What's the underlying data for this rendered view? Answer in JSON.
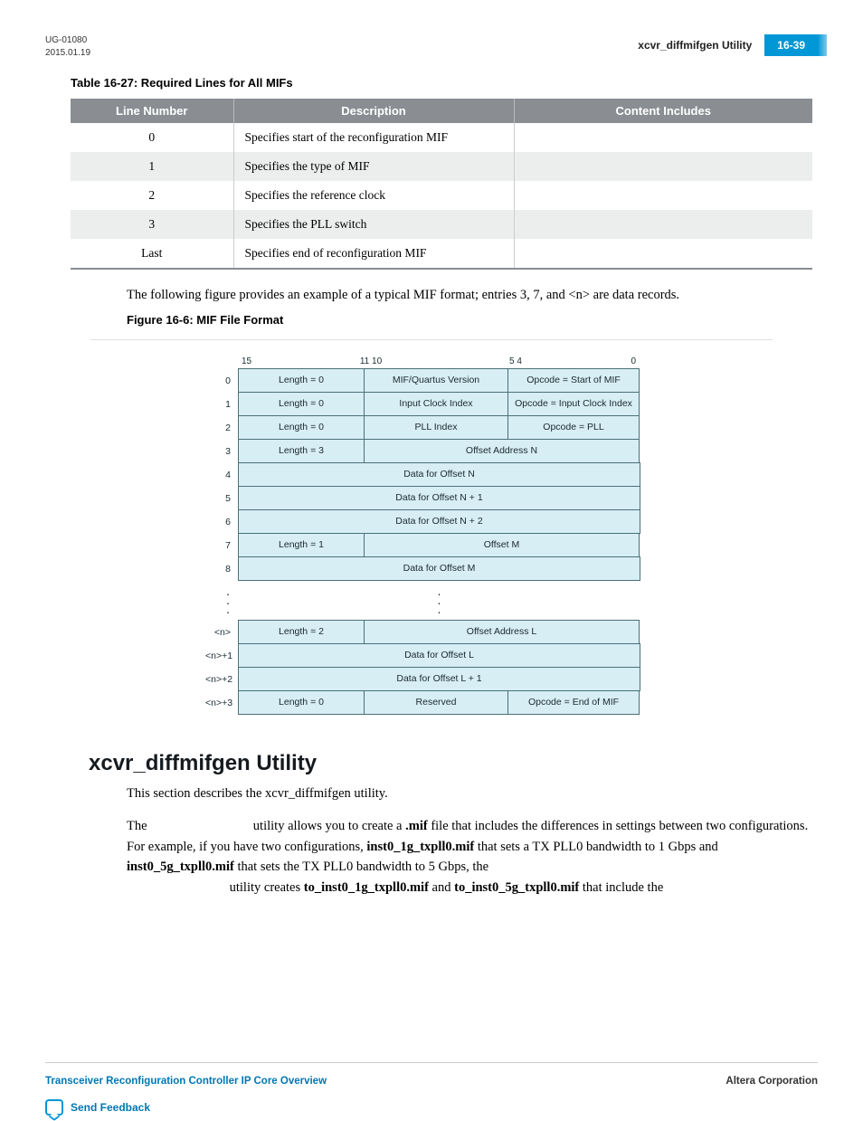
{
  "header": {
    "doc_id": "UG-01080",
    "date": "2015.01.19",
    "running_title": "xcvr_diffmifgen Utility",
    "page_ref": "16-39"
  },
  "table_caption": "Table 16-27: Required Lines for All MIFs",
  "table_headers": {
    "h1": "Line Number",
    "h2": "Description",
    "h3": "Content Includes"
  },
  "table_rows": [
    {
      "line": "0",
      "desc": "Specifies start of the reconfiguration MIF",
      "content": ""
    },
    {
      "line": "1",
      "desc": "Specifies the type of MIF",
      "content": ""
    },
    {
      "line": "2",
      "desc": "Specifies the reference clock",
      "content": ""
    },
    {
      "line": "3",
      "desc": "Specifies the PLL switch",
      "content": ""
    },
    {
      "line": "Last",
      "desc": "Specifies end of reconfiguration MIF",
      "content": ""
    }
  ],
  "para1": "The following figure provides an example of a typical MIF format; entries 3, 7, and <n> are data records.",
  "figure_caption": "Figure 16-6: MIF File Format",
  "bits": {
    "b15": "15",
    "b1110": "11 10",
    "b54": "5 4",
    "b0": "0"
  },
  "mif": [
    {
      "rn": "0",
      "cells": [
        {
          "w": "len",
          "t": "Length = 0"
        },
        {
          "w": "mid",
          "t": "MIF/Quartus Version"
        },
        {
          "w": "op",
          "t": "Opcode = Start of MIF"
        }
      ]
    },
    {
      "rn": "1",
      "cells": [
        {
          "w": "len",
          "t": "Length = 0"
        },
        {
          "w": "mid",
          "t": "Input Clock Index"
        },
        {
          "w": "op",
          "t": "Opcode = Input Clock Index"
        }
      ]
    },
    {
      "rn": "2",
      "cells": [
        {
          "w": "len",
          "t": "Length = 0"
        },
        {
          "w": "mid",
          "t": "PLL Index"
        },
        {
          "w": "op",
          "t": "Opcode = PLL"
        }
      ]
    },
    {
      "rn": "3",
      "cells": [
        {
          "w": "len",
          "t": "Length = 3"
        },
        {
          "w": "span23",
          "t": "Offset Address N"
        }
      ]
    },
    {
      "rn": "4",
      "cells": [
        {
          "w": "full",
          "t": "Data for Offset N"
        }
      ]
    },
    {
      "rn": "5",
      "cells": [
        {
          "w": "full",
          "t": "Data for Offset N + 1"
        }
      ]
    },
    {
      "rn": "6",
      "cells": [
        {
          "w": "full",
          "t": "Data for Offset N + 2"
        }
      ]
    },
    {
      "rn": "7",
      "cells": [
        {
          "w": "len",
          "t": "Length = 1"
        },
        {
          "w": "span23",
          "t": "Offset M"
        }
      ]
    },
    {
      "rn": "8",
      "cells": [
        {
          "w": "full",
          "t": "Data for Offset M"
        }
      ]
    }
  ],
  "mif2": [
    {
      "rn": "<n>",
      "cells": [
        {
          "w": "len",
          "t": "Length = 2"
        },
        {
          "w": "span23",
          "t": "Offset Address  L"
        }
      ]
    },
    {
      "rn": "<n>+1",
      "cells": [
        {
          "w": "full",
          "t": "Data for Offset L"
        }
      ]
    },
    {
      "rn": "<n>+2",
      "cells": [
        {
          "w": "full",
          "t": "Data for Offset L + 1"
        }
      ]
    },
    {
      "rn": "<n>+3",
      "cells": [
        {
          "w": "len",
          "t": "Length = 0"
        },
        {
          "w": "mid",
          "t": "Reserved"
        },
        {
          "w": "op",
          "t": "Opcode = End of MIF"
        }
      ]
    }
  ],
  "section_heading": "xcvr_diffmifgen Utility",
  "p2": "This section describes the xcvr_diffmifgen utility.",
  "p3_a": "The ",
  "p3_b": " utility allows you to create a ",
  "p3_mif": ".mif",
  "p3_c": " file that includes the differences in settings between two configurations. For example, if you have two configurations, ",
  "p3_f1": "inst0_1g_txpll0.mif",
  "p3_d": " that sets a TX PLL0 bandwidth to 1 Gbps and ",
  "p3_f2": "inst0_5g_txpll0.mif",
  "p3_e": " that sets the TX PLL0 bandwidth to 5 Gbps, the ",
  "p3_f": " utility creates ",
  "p3_f3": "to_inst0_1g_txpll0.mif",
  "p3_g": " and ",
  "p3_f4": "to_inst0_5g_txpll0.mif",
  "p3_h": " that include the",
  "footer": {
    "left": "Transceiver Reconfiguration Controller IP Core Overview",
    "right": "Altera Corporation",
    "feedback": "Send Feedback"
  }
}
